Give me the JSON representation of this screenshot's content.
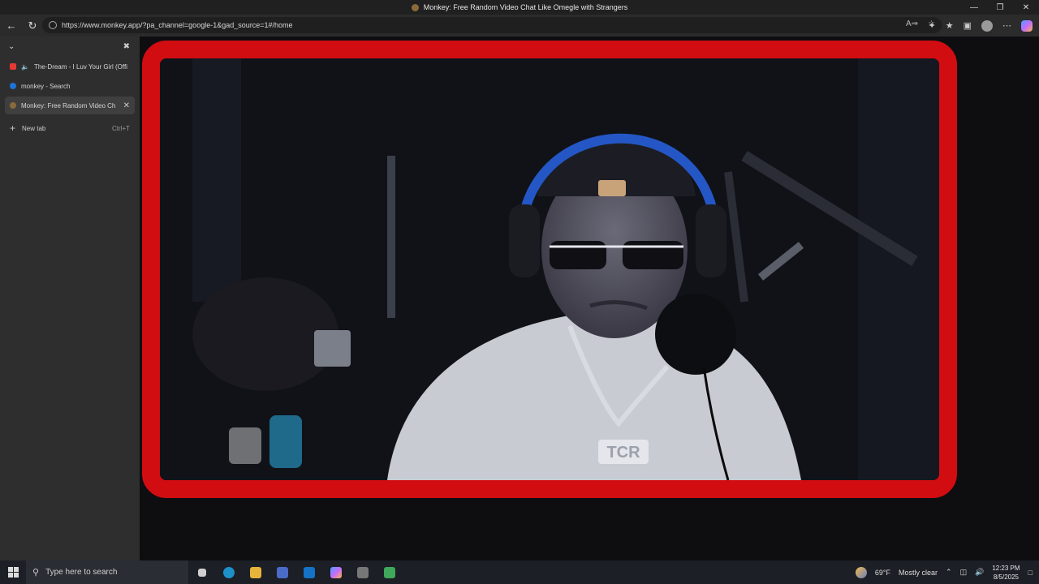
{
  "window": {
    "title": "Monkey: Free Random Video Chat Like Omegle with Strangers",
    "controls": [
      "minimize-icon",
      "restore-icon",
      "close-icon"
    ]
  },
  "toolbar": {
    "url": "https://www.monkey.app/?pa_channel=google-1&gad_source=1#/home",
    "icons": [
      "back-icon",
      "refresh-icon",
      "read-aloud-icon",
      "favorite-star-icon",
      "extensions-icon",
      "favorites-icon",
      "profile-icon",
      "more-icon",
      "copilot-icon"
    ]
  },
  "sidebar": {
    "tabs": [
      {
        "label": "The-Dream - I Luv Your Girl (Offi",
        "audio": true,
        "color": "#e53935"
      },
      {
        "label": "monkey - Search",
        "audio": false,
        "color": "#1e73d6"
      },
      {
        "label": "Monkey: Free Random Video Ch",
        "audio": false,
        "color": "#8a6a3a",
        "active": true
      }
    ],
    "new_tab": {
      "label": "New tab",
      "shortcut": "Ctrl+T"
    }
  },
  "video": {
    "frame_color": "#d10d12",
    "chain_text": "TCR"
  },
  "taskbar": {
    "search_placeholder": "Type here to search",
    "apps": [
      {
        "name": "task-view-icon",
        "color": "#cfcfcf"
      },
      {
        "name": "edge-icon",
        "color": "#1e90c8"
      },
      {
        "name": "file-explorer-icon",
        "color": "#e8b33a"
      },
      {
        "name": "store-icon",
        "color": "#4a6cc8"
      },
      {
        "name": "outlook-icon",
        "color": "#1473c6"
      },
      {
        "name": "copilot-icon",
        "color": "#b26bff"
      },
      {
        "name": "app-icon",
        "color": "#777777"
      },
      {
        "name": "minecraft-icon",
        "color": "#3fa85a"
      }
    ],
    "weather": {
      "temp": "69°F",
      "condition": "Mostly clear"
    },
    "clock": {
      "time": "12:23 PM",
      "date": "8/5/2025"
    }
  }
}
